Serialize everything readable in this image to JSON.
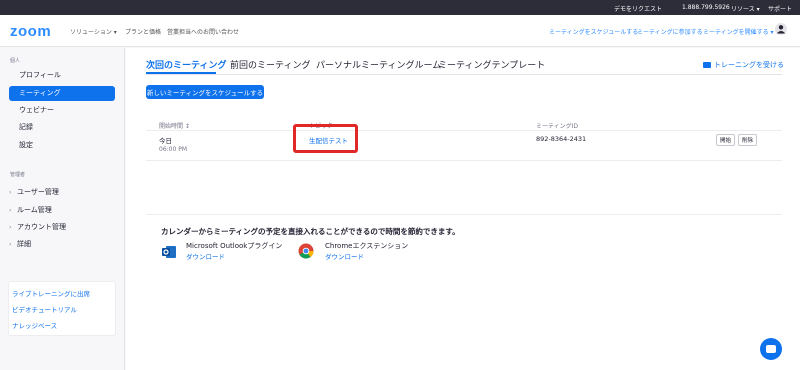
{
  "topbar": {
    "request_demo": "デモをリクエスト",
    "phone": "1.888.799.5926",
    "resources": "リソース ▾",
    "support": "サポート"
  },
  "navbar": {
    "logo": "zoom",
    "solutions": "ソリューション ▾",
    "plans": "プランと価格",
    "contact_sales": "営業担当へのお問い合わせ",
    "schedule_meeting": "ミーティングをスケジュールする",
    "join_meeting": "ミーティングに参加する",
    "host_meeting": "ミーティングを開催する ▾"
  },
  "sidebar": {
    "personal_title": "個人",
    "items": [
      {
        "label": "プロフィール",
        "active": false
      },
      {
        "label": "ミーティング",
        "active": true
      },
      {
        "label": "ウェビナー",
        "active": false
      },
      {
        "label": "記録",
        "active": false
      },
      {
        "label": "設定",
        "active": false
      }
    ],
    "admin_title": "管理者",
    "groups": [
      {
        "label": "ユーザー管理"
      },
      {
        "label": "ルーム管理"
      },
      {
        "label": "アカウント管理"
      },
      {
        "label": "詳細"
      }
    ],
    "help_links": [
      {
        "label": "ライブトレーニングに出席"
      },
      {
        "label": "ビデオチュートリアル"
      },
      {
        "label": "ナレッジベース"
      }
    ]
  },
  "main": {
    "tabs": [
      {
        "label": "次回のミーティング",
        "active": true
      },
      {
        "label": "前回のミーティング",
        "active": false
      },
      {
        "label": "パーソナルミーティングルーム",
        "active": false
      },
      {
        "label": "ミーティングテンプレート",
        "active": false
      }
    ],
    "training_link": "トレーニングを受ける",
    "schedule_button": "新しいミーティングをスケジュールする",
    "table": {
      "headers": {
        "start_time": "開始時間 ↕",
        "topic": "トピック",
        "meeting_id": "ミーティングID"
      },
      "rows": [
        {
          "date": "今日",
          "time": "06:00 PM",
          "topic": "生配信テスト",
          "meeting_id": "892-8364-2431",
          "start_label": "開始",
          "delete_label": "削除"
        }
      ]
    },
    "calendar": {
      "title": "カレンダーからミーティングの予定を直接入れることができるので時間を節約できます。",
      "outlook_name": "Microsoft Outlookプラグイン",
      "outlook_download": "ダウンロード",
      "chrome_name": "Chromeエクステンション",
      "chrome_download": "ダウンロード"
    }
  },
  "colors": {
    "brand_blue": "#0e72ed",
    "highlight_red": "#e02828",
    "topbar_dark": "#2d2d3a"
  }
}
